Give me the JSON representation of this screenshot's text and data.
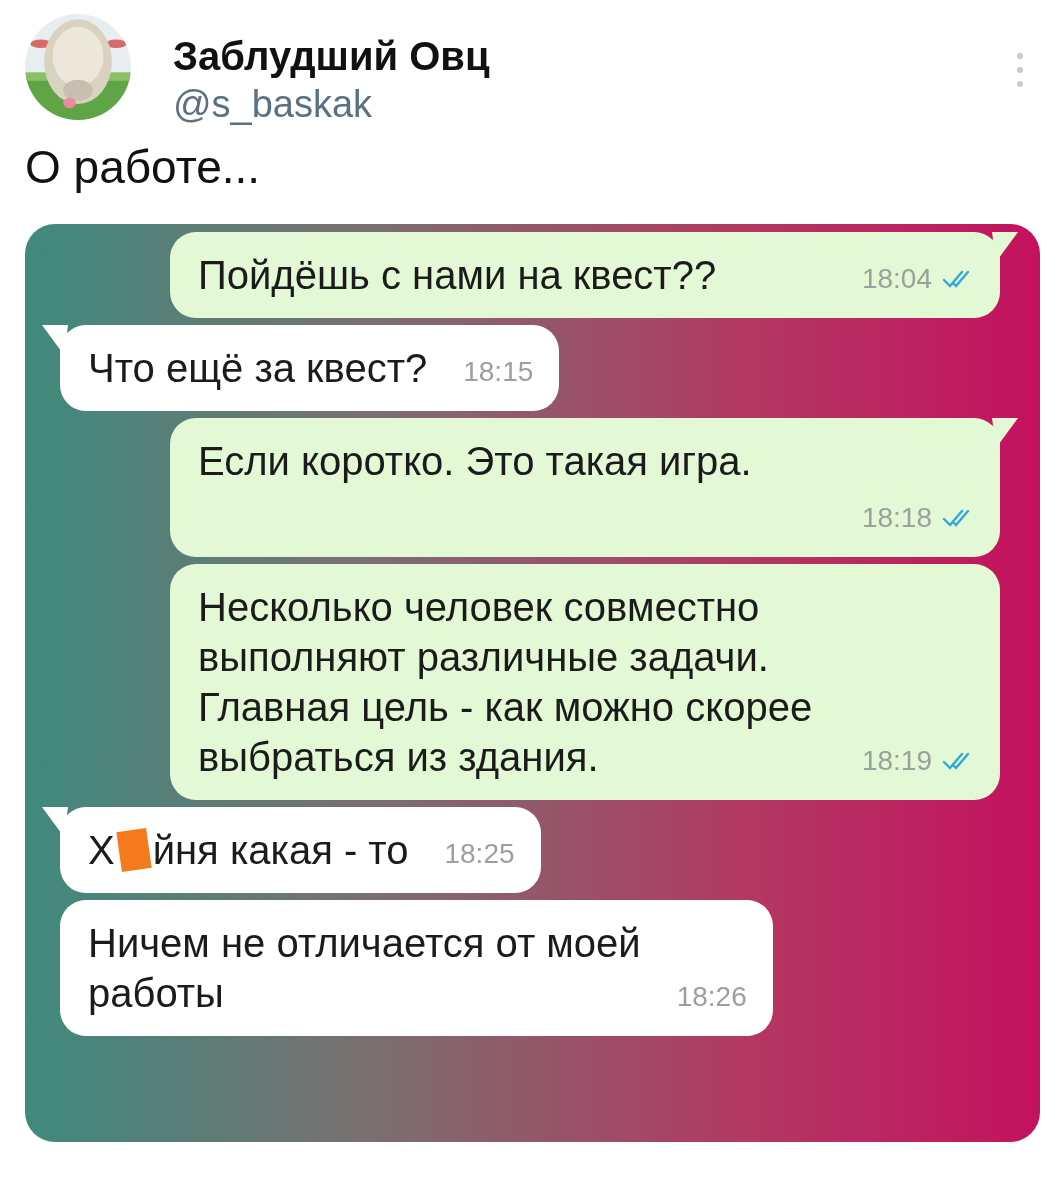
{
  "tweet": {
    "author": {
      "name": "Заблудший Овц",
      "handle": "@s_baskak"
    },
    "text": "О работе..."
  },
  "chat": {
    "messages": [
      {
        "kind": "sent",
        "tail": true,
        "lines": [
          "Пойдёшь с нами на квест??"
        ],
        "time": "18:04",
        "read": true,
        "time_below": false
      },
      {
        "kind": "received",
        "tail": true,
        "lines": [
          "Что ещё за квест?"
        ],
        "time": "18:15",
        "time_below": false
      },
      {
        "kind": "sent",
        "tail": true,
        "lines": [
          "Если коротко. Это такая игра."
        ],
        "time": "18:18",
        "read": true,
        "time_below": true
      },
      {
        "kind": "sent",
        "tail": false,
        "lines": [
          "Несколько человек совместно",
          "выполняют различные задачи.",
          "Главная цель - как можно скорее",
          "выбраться из здания."
        ],
        "time": "18:19",
        "read": true,
        "time_below": false
      },
      {
        "kind": "received",
        "tail": true,
        "censored": true,
        "before": "Х",
        "lines": [
          "йня какая - то"
        ],
        "time": "18:25",
        "time_below": false
      },
      {
        "kind": "received",
        "tail": false,
        "lines": [
          "Ничем не отличается от моей",
          "работы"
        ],
        "time": "18:26",
        "time_below": false
      }
    ]
  }
}
